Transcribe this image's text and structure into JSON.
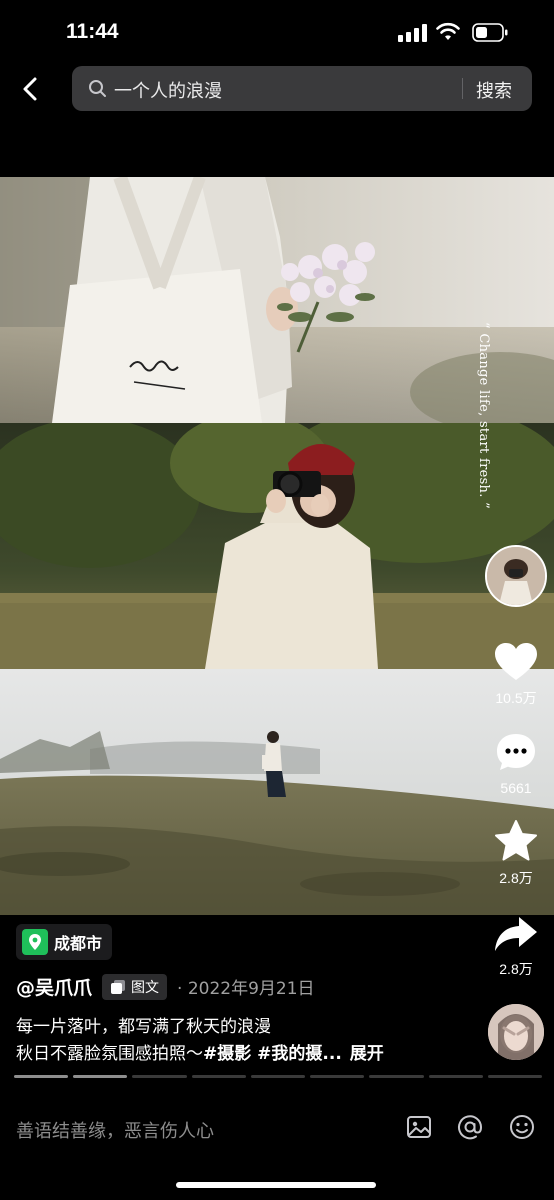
{
  "status_bar": {
    "time": "11:44"
  },
  "header": {
    "search_query": "一个人的浪漫",
    "search_button": "搜索"
  },
  "overlay_quote": "“ Change life, start fresh. ”",
  "actions": {
    "likes": "10.5万",
    "comments": "5661",
    "favorites": "2.8万",
    "shares": "2.8万"
  },
  "post": {
    "location": "成都市",
    "author": "@吴爪爪",
    "type_label": "图文",
    "date": "· 2022年9月21日",
    "caption_line1": "每一片落叶，都写满了秋天的浪漫",
    "caption_line2_text": "秋日不露脸氛围感拍照～",
    "caption_line2_tags": "#摄影 #我的摄...",
    "expand_label": "展开"
  },
  "progress": {
    "total": 9,
    "current": 2
  },
  "comment_bar": {
    "placeholder": "善语结善缘，恶言伤人心"
  },
  "icons": [
    "back-icon",
    "search-icon",
    "heart-icon",
    "comment-icon",
    "star-icon",
    "share-icon",
    "location-pin-icon",
    "gallery-icon",
    "image-icon",
    "at-icon",
    "emoji-icon"
  ],
  "colors": {
    "location_pin": "#1fbf5a",
    "search_bg": "#3a3a3c"
  }
}
